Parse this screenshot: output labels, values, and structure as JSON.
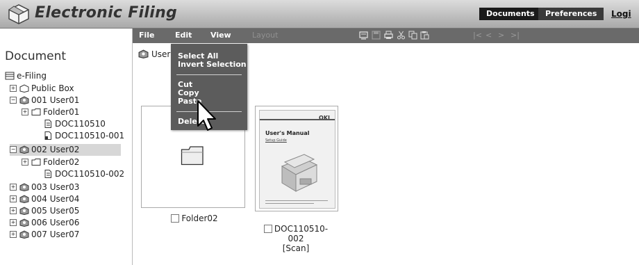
{
  "header": {
    "app_title": "Electronic Filing",
    "tabs": [
      {
        "label": "Documents",
        "active": true
      },
      {
        "label": "Preferences",
        "active": false
      }
    ],
    "logout_label": "Logi"
  },
  "sidebar": {
    "heading": "Document",
    "root": "e-Filing",
    "items": [
      {
        "label": "Public Box",
        "icon": "box-icon",
        "toggle": "+"
      },
      {
        "label": "001 User01",
        "icon": "user-box-icon",
        "toggle": "−"
      },
      {
        "label": "Folder01",
        "icon": "folder-icon",
        "toggle": "+"
      },
      {
        "label": "DOC110510",
        "icon": "document-icon"
      },
      {
        "label": "DOC110510-001",
        "icon": "document-icon"
      },
      {
        "label": "002 User02",
        "icon": "user-box-icon",
        "toggle": "−",
        "selected": true
      },
      {
        "label": "Folder02",
        "icon": "folder-icon",
        "toggle": "+"
      },
      {
        "label": "DOC110510-002",
        "icon": "document-icon"
      },
      {
        "label": "003 User03",
        "icon": "user-box-icon",
        "toggle": "+"
      },
      {
        "label": "004 User04",
        "icon": "user-box-icon",
        "toggle": "+"
      },
      {
        "label": "005 User05",
        "icon": "user-box-icon",
        "toggle": "+"
      },
      {
        "label": "006 User06",
        "icon": "user-box-icon",
        "toggle": "+"
      },
      {
        "label": "007 User07",
        "icon": "user-box-icon",
        "toggle": "+"
      }
    ]
  },
  "toolbar": {
    "menus": [
      "File",
      "Edit",
      "View",
      "Layout"
    ],
    "icons": [
      "properties-icon",
      "save-icon",
      "print-icon",
      "cut-icon",
      "copy-icon",
      "paste-icon"
    ],
    "nav": [
      "|<",
      "<",
      ">",
      ">|"
    ]
  },
  "edit_menu": {
    "items": [
      "Select All",
      "Invert Selection",
      "Cut",
      "Copy",
      "Paste",
      "Delete"
    ]
  },
  "content": {
    "breadcrumb": "User0",
    "items": [
      {
        "name": "Folder02",
        "type": "folder"
      },
      {
        "name_lines": [
          "DOC110510-",
          "002",
          "[Scan]"
        ],
        "type": "document",
        "doc_brand": "OKI",
        "doc_title": "User's Manual",
        "doc_subtitle": "Setup Guide"
      }
    ]
  },
  "colors": {
    "toolbar_bg": "#6a6a6a",
    "menu_bg": "#5c5c5c",
    "selected_row": "#d7d7d7"
  }
}
